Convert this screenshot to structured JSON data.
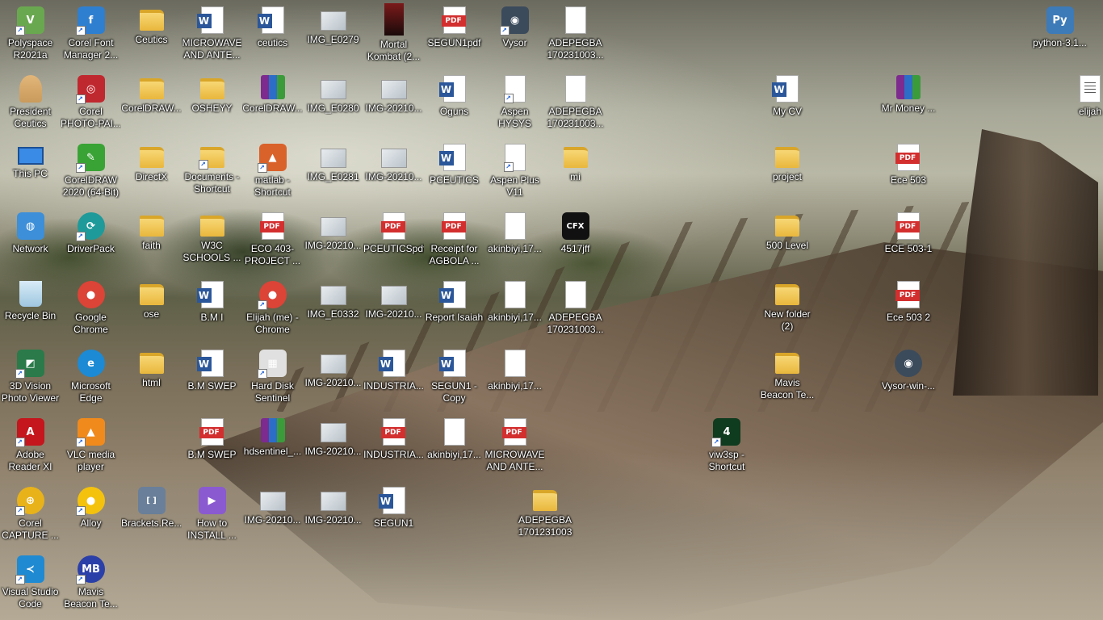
{
  "desktop": {
    "icons": [
      {
        "label": "Polyspace\nR2021a",
        "icon": "polyspace-app-icon",
        "type": "app",
        "color": "#6aa84f",
        "glyph": "V",
        "shortcut": true
      },
      {
        "label": "Corel Font\nManager 2...",
        "icon": "corel-font-manager-icon",
        "type": "app",
        "color": "#2f7fd0",
        "glyph": "f",
        "shortcut": true
      },
      {
        "label": "Ceutics",
        "icon": "folder-icon",
        "type": "folder"
      },
      {
        "label": "MICROWAVE\nAND ANTE...",
        "icon": "word-document-icon",
        "type": "word"
      },
      {
        "label": "ceutics",
        "icon": "word-document-icon",
        "type": "word"
      },
      {
        "label": "IMG_E0279",
        "icon": "image-file-icon",
        "type": "img"
      },
      {
        "label": "Mortal\nKombat (2...",
        "icon": "game-cover-icon",
        "type": "game"
      },
      {
        "label": "SEGUN1pdf",
        "icon": "pdf-file-icon",
        "type": "pdf"
      },
      {
        "label": "Vysor",
        "icon": "vysor-app-icon",
        "type": "app",
        "color": "#3b4b5c",
        "glyph": "◉",
        "shortcut": true
      },
      {
        "label": "ADEPEGBA\n170231003...",
        "icon": "blank-file-icon",
        "type": "doc"
      },
      {
        "label": "python-3.1...",
        "icon": "python-installer-icon",
        "type": "app",
        "color": "#3d7ab8",
        "glyph": "Py"
      },
      {
        "label": "President\nCeutics",
        "icon": "user-folder-icon",
        "type": "person"
      },
      {
        "label": "Corel\nPHOTO-PAI...",
        "icon": "corel-photo-paint-icon",
        "type": "app",
        "color": "#c0282f",
        "glyph": "◎",
        "shortcut": true
      },
      {
        "label": "CorelDRAW...",
        "icon": "folder-icon",
        "type": "folder"
      },
      {
        "label": "OSHEYY",
        "icon": "folder-icon",
        "type": "folder"
      },
      {
        "label": "CorelDRAW...",
        "icon": "winrar-archive-icon",
        "type": "rar"
      },
      {
        "label": "IMG_E0280",
        "icon": "image-file-icon",
        "type": "img"
      },
      {
        "label": "IMG-20210...",
        "icon": "image-file-icon",
        "type": "img"
      },
      {
        "label": "Oguns",
        "icon": "word-document-icon",
        "type": "word"
      },
      {
        "label": "Aspen HYSYS\nV11",
        "icon": "shortcut-file-icon",
        "type": "doc",
        "shortcut": true
      },
      {
        "label": "ADEPEGBA\n170231003...",
        "icon": "blank-file-icon",
        "type": "doc"
      },
      {
        "label": "My CV",
        "icon": "word-document-icon",
        "type": "word"
      },
      {
        "label": "Mr Money ...",
        "icon": "winrar-archive-icon",
        "type": "rar"
      },
      {
        "label": "elijah",
        "icon": "text-file-icon",
        "type": "text"
      },
      {
        "label": "This PC",
        "icon": "this-pc-icon",
        "type": "pc"
      },
      {
        "label": "CorelDRAW\n2020 (64-Bit)",
        "icon": "coreldraw-app-icon",
        "type": "app",
        "color": "#3aa335",
        "glyph": "✎",
        "shortcut": true
      },
      {
        "label": "DirectX",
        "icon": "folder-icon",
        "type": "folder"
      },
      {
        "label": "Documents -\nShortcut",
        "icon": "folder-shortcut-icon",
        "type": "folder",
        "shortcut": true
      },
      {
        "label": "matlab -\nShortcut",
        "icon": "matlab-icon",
        "type": "app",
        "color": "#d9622b",
        "glyph": "▲",
        "shortcut": true
      },
      {
        "label": "IMG_E0281",
        "icon": "image-file-icon",
        "type": "img"
      },
      {
        "label": "IMG-20210...",
        "icon": "image-file-icon",
        "type": "img"
      },
      {
        "label": "PCEUTICS",
        "icon": "word-document-icon",
        "type": "word"
      },
      {
        "label": "Aspen Plus\nV11",
        "icon": "shortcut-file-icon",
        "type": "doc",
        "shortcut": true
      },
      {
        "label": "mi",
        "icon": "zip-folder-icon",
        "type": "folder"
      },
      {
        "label": "project",
        "icon": "folder-icon",
        "type": "folder"
      },
      {
        "label": "Ece 503",
        "icon": "pdf-file-icon",
        "type": "pdf"
      },
      {
        "label": "Network",
        "icon": "network-icon",
        "type": "app",
        "color": "#3c8fd8",
        "glyph": "◍"
      },
      {
        "label": "DriverPack",
        "icon": "driverpack-icon",
        "type": "round",
        "color": "#1e9a9a",
        "glyph": "⟳",
        "shortcut": true
      },
      {
        "label": "faith",
        "icon": "folder-icon",
        "type": "folder"
      },
      {
        "label": "W3C\nSCHOOLS ...",
        "icon": "folder-icon",
        "type": "folder"
      },
      {
        "label": "ECO 403-\nPROJECT ...",
        "icon": "pdf-file-icon",
        "type": "pdf"
      },
      {
        "label": "IMG-20210...",
        "icon": "image-file-icon",
        "type": "img"
      },
      {
        "label": "PCEUTICSpdf",
        "icon": "pdf-file-icon",
        "type": "pdf"
      },
      {
        "label": "Receipt for\nAGBOLA ...",
        "icon": "pdf-file-icon",
        "type": "pdf"
      },
      {
        "label": "akinbiyi,17...",
        "icon": "blank-file-icon",
        "type": "doc"
      },
      {
        "label": "4517jff",
        "icon": "cfx-image-icon",
        "type": "app",
        "color": "#111111",
        "glyph": "CFX"
      },
      {
        "label": "500 Level",
        "icon": "folder-icon",
        "type": "folder"
      },
      {
        "label": "ECE 503-1",
        "icon": "pdf-file-icon",
        "type": "pdf"
      },
      {
        "label": "Recycle Bin",
        "icon": "recycle-bin-icon",
        "type": "recycle"
      },
      {
        "label": "Google\nChrome",
        "icon": "chrome-icon",
        "type": "round",
        "color": "#db4437",
        "glyph": "●"
      },
      {
        "label": "ose",
        "icon": "folder-icon",
        "type": "folder"
      },
      {
        "label": "B.M I",
        "icon": "word-document-icon",
        "type": "word"
      },
      {
        "label": "Elijah (me) -\nChrome",
        "icon": "chrome-icon",
        "type": "round",
        "color": "#db4437",
        "glyph": "●",
        "shortcut": true
      },
      {
        "label": "IMG_E0332",
        "icon": "image-file-icon",
        "type": "img"
      },
      {
        "label": "IMG-20210...",
        "icon": "image-file-icon",
        "type": "img"
      },
      {
        "label": "Report Isaiah",
        "icon": "word-document-icon",
        "type": "word"
      },
      {
        "label": "akinbiyi,17...",
        "icon": "blank-file-icon",
        "type": "doc"
      },
      {
        "label": "ADEPEGBA\n170231003...",
        "icon": "blank-file-icon",
        "type": "doc"
      },
      {
        "label": "New folder\n(2)",
        "icon": "folder-icon",
        "type": "folder"
      },
      {
        "label": "Ece 503 2",
        "icon": "pdf-file-icon",
        "type": "pdf"
      },
      {
        "label": "3D Vision\nPhoto Viewer",
        "icon": "3d-vision-icon",
        "type": "app",
        "color": "#2a7a4a",
        "glyph": "◩",
        "shortcut": true
      },
      {
        "label": "Microsoft\nEdge",
        "icon": "edge-icon",
        "type": "round",
        "color": "#1c8ad4",
        "glyph": "e"
      },
      {
        "label": "html",
        "icon": "folder-icon",
        "type": "folder"
      },
      {
        "label": "B.M SWEP",
        "icon": "word-document-icon",
        "type": "word"
      },
      {
        "label": "Hard Disk\nSentinel",
        "icon": "hard-disk-sentinel-icon",
        "type": "app",
        "color": "#e0e0e0",
        "glyph": "▦",
        "shortcut": true
      },
      {
        "label": "IMG-20210...",
        "icon": "image-file-icon",
        "type": "img"
      },
      {
        "label": "INDUSTRIA...",
        "icon": "word-document-icon",
        "type": "word"
      },
      {
        "label": "SEGUN1 -\nCopy",
        "icon": "word-document-icon",
        "type": "word"
      },
      {
        "label": "akinbiyi,17...",
        "icon": "blank-file-icon",
        "type": "doc"
      },
      {
        "label": "Mavis\nBeacon Te...",
        "icon": "folder-icon",
        "type": "folder"
      },
      {
        "label": "Vysor-win-...",
        "icon": "vysor-app-icon",
        "type": "round",
        "color": "#3b4b5c",
        "glyph": "◉"
      },
      {
        "label": "Adobe\nReader XI",
        "icon": "adobe-reader-icon",
        "type": "app",
        "color": "#c4161c",
        "glyph": "A",
        "shortcut": true
      },
      {
        "label": "VLC media\nplayer",
        "icon": "vlc-icon",
        "type": "app",
        "color": "#f08a1c",
        "glyph": "▲",
        "shortcut": true
      },
      {
        "label": "B.M SWEP",
        "icon": "pdf-file-icon",
        "type": "pdf"
      },
      {
        "label": "hdsentinel_...",
        "icon": "winrar-archive-icon",
        "type": "rar"
      },
      {
        "label": "IMG-20210...",
        "icon": "image-file-icon",
        "type": "img"
      },
      {
        "label": "INDUSTRIA...",
        "icon": "pdf-file-icon",
        "type": "pdf"
      },
      {
        "label": "akinbiyi,17...",
        "icon": "blank-file-icon",
        "type": "doc"
      },
      {
        "label": "MICROWAVE\nAND ANTE...",
        "icon": "pdf-file-icon",
        "type": "pdf"
      },
      {
        "label": "viw3sp -\nShortcut",
        "icon": "viw3sp-icon",
        "type": "app",
        "color": "#0f3b1e",
        "glyph": "4",
        "shortcut": true
      },
      {
        "label": "Corel\nCAPTURE ...",
        "icon": "corel-capture-icon",
        "type": "round",
        "color": "#e8b21a",
        "glyph": "⊕",
        "shortcut": true
      },
      {
        "label": "Alloy",
        "icon": "chrome-profile-icon",
        "type": "round",
        "color": "#f4c20d",
        "glyph": "●",
        "shortcut": true
      },
      {
        "label": "Brackets.Re...",
        "icon": "brackets-installer-icon",
        "type": "app",
        "color": "#6a7f99",
        "glyph": "[ ]"
      },
      {
        "label": "How to\nINSTALL ...",
        "icon": "video-file-icon",
        "type": "app",
        "color": "#8a5ad0",
        "glyph": "▶"
      },
      {
        "label": "IMG-20210...",
        "icon": "image-file-icon",
        "type": "img"
      },
      {
        "label": "IMG-20210...",
        "icon": "image-file-icon",
        "type": "img"
      },
      {
        "label": "SEGUN1",
        "icon": "word-document-icon",
        "type": "word"
      },
      {
        "label": "ADEPEGBA\n1701231003",
        "icon": "zip-folder-icon",
        "type": "folder"
      },
      {
        "label": "Visual Studio\nCode",
        "icon": "vscode-icon",
        "type": "app",
        "color": "#1f8ad2",
        "glyph": "≺",
        "shortcut": true
      },
      {
        "label": "Mavis\nBeacon Te...",
        "icon": "mavis-beacon-icon",
        "type": "round",
        "color": "#2b3fa8",
        "glyph": "MB",
        "shortcut": true
      }
    ]
  }
}
